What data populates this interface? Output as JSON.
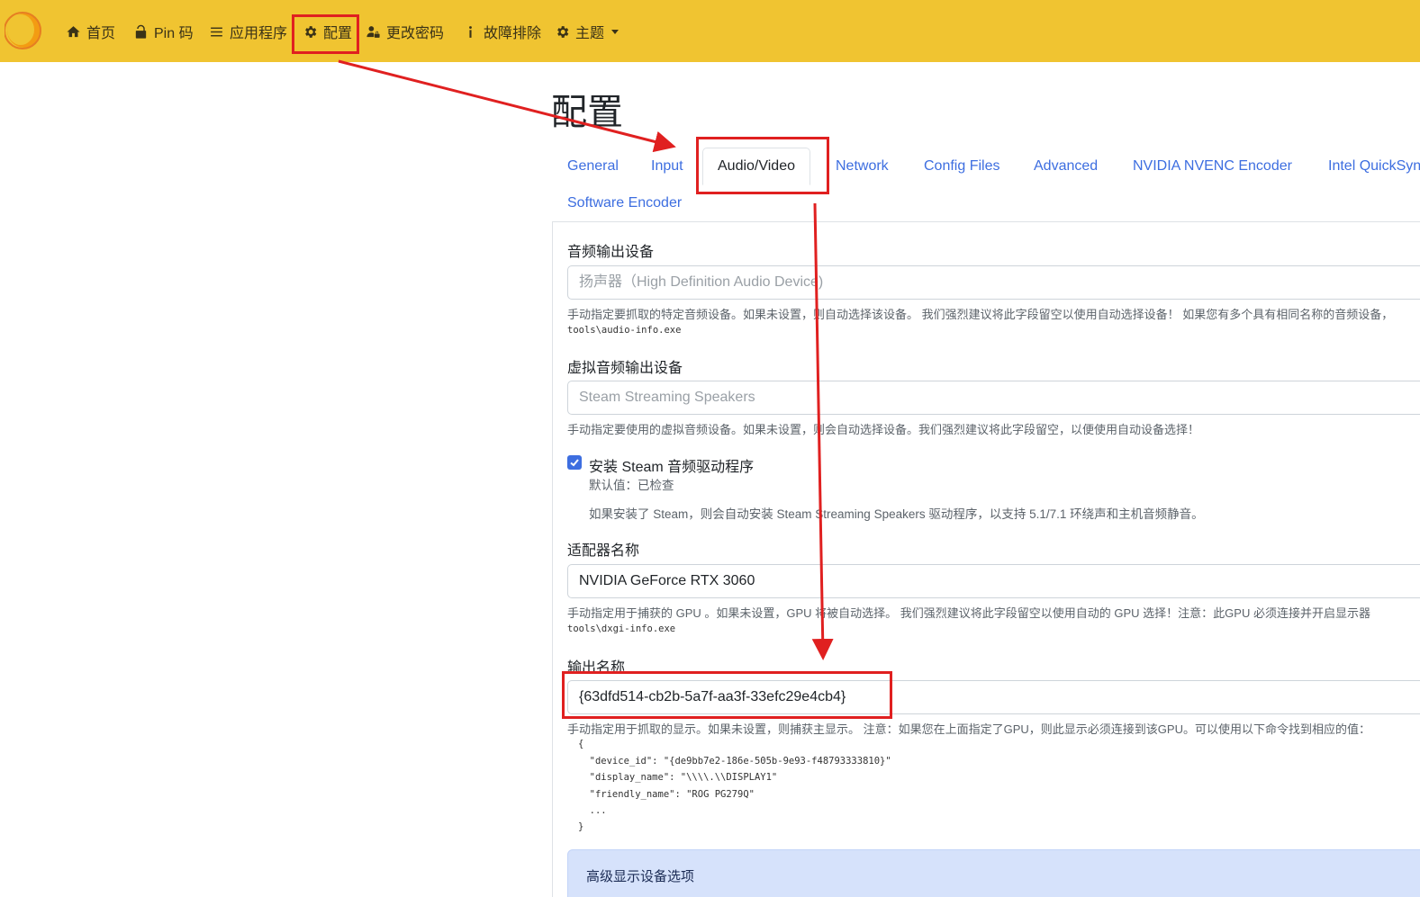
{
  "nav": {
    "items": [
      {
        "label": "首页",
        "icon": "home-icon"
      },
      {
        "label": "Pin 码",
        "icon": "unlock-icon"
      },
      {
        "label": "应用程序",
        "icon": "list-icon"
      },
      {
        "label": "配置",
        "icon": "gear-icon"
      },
      {
        "label": "更改密码",
        "icon": "user-lock-icon"
      },
      {
        "label": "故障排除",
        "icon": "info-icon"
      },
      {
        "label": "主题",
        "icon": "gear-icon"
      }
    ]
  },
  "page": {
    "title": "配置"
  },
  "tabs": {
    "general": "General",
    "input": "Input",
    "audio_video": "Audio/Video",
    "network": "Network",
    "config_files": "Config Files",
    "advanced": "Advanced",
    "nvenc": "NVIDIA NVENC Encoder",
    "quicksync": "Intel QuickSync",
    "software": "Software Encoder"
  },
  "audio_sink": {
    "label": "音频输出设备",
    "placeholder": "扬声器（High Definition Audio Device)",
    "help": "手动指定要抓取的特定音频设备。如果未设置，则自动选择该设备。 我们强烈建议将此字段留空以使用自动选择设备！ 如果您有多个具有相同名称的音频设备，",
    "help_tool": "tools\\audio-info.exe"
  },
  "virtual_sink": {
    "label": "虚拟音频输出设备",
    "placeholder": "Steam Streaming Speakers",
    "help": "手动指定要使用的虚拟音频设备。如果未设置，则会自动选择设备。我们强烈建议将此字段留空，以便使用自动设备选择！"
  },
  "install_steam": {
    "label": "安装 Steam 音频驱动程序",
    "default": "默认值：已检查",
    "help": "如果安装了 Steam，则会自动安装 Steam Streaming Speakers 驱动程序，以支持 5.1/7.1 环绕声和主机音频静音。"
  },
  "adapter": {
    "label": "适配器名称",
    "value": "NVIDIA GeForce RTX 3060",
    "help": "手动指定用于捕获的 GPU 。如果未设置，GPU 将被自动选择。 我们强烈建议将此字段留空以使用自动的 GPU 选择！注意：此GPU 必须连接并开启显示器",
    "help_tool": "tools\\dxgi-info.exe"
  },
  "output": {
    "label": "输出名称",
    "value": "{63dfd514-cb2b-5a7f-aa3f-33efc29e4cb4}",
    "help": "手动指定用于抓取的显示。如果未设置，则捕获主显示。 注意：如果您在上面指定了GPU，则此显示必须连接到该GPU。可以使用以下命令找到相应的值：",
    "code": [
      "{",
      "  \"device_id\": \"{de9bb7e2-186e-505b-9e93-f48793333810}\"",
      "  \"display_name\": \"\\\\\\\\.\\\\DISPLAY1\"",
      "  \"friendly_name\": \"ROG PG279Q\"",
      "  ...",
      "}"
    ]
  },
  "advanced_display": {
    "label": "高级显示设备选项"
  },
  "colors": {
    "navbar": "#f0c431",
    "link": "#3d6ee0",
    "annotation": "#e02020"
  }
}
